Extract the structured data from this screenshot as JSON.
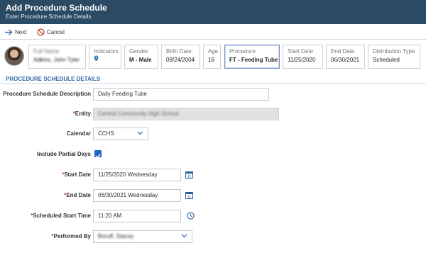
{
  "header": {
    "title": "Add Procedure Schedule",
    "subtitle": "Enter Procedure Schedule Details",
    "color": "#2b4a63"
  },
  "toolbar": {
    "next_label": "Next",
    "cancel_label": "Cancel",
    "next_icon": "arrow-right-icon",
    "cancel_icon": "cancel-circle-icon"
  },
  "cards": [
    {
      "label": "Full Name",
      "value": "Adkins, John Tyler",
      "blurred": true
    },
    {
      "label": "Indicators",
      "value": "",
      "icon": "location-pin-icon"
    },
    {
      "label": "Gender",
      "value": "M - Male"
    },
    {
      "label": "Birth Date",
      "value": "09/24/2004"
    },
    {
      "label": "Age",
      "value": "16"
    },
    {
      "label": "Procedure",
      "value": "FT - Feeding Tube",
      "selected": true
    },
    {
      "label": "Start Date",
      "value": "11/25/2020"
    },
    {
      "label": "End Date",
      "value": "06/30/2021"
    },
    {
      "label": "Distribution Type",
      "value": "Scheduled"
    }
  ],
  "section_title": "PROCEDURE SCHEDULE DETAILS",
  "form": {
    "description": {
      "label": "Procedure Schedule Description",
      "value": "Daily Feeding Tube"
    },
    "entity": {
      "required": "*",
      "label": "Entity",
      "value": "Central Community High School",
      "blurred": true
    },
    "calendar": {
      "label": "Calendar",
      "value": "CCHS"
    },
    "partial_days": {
      "label": "Include Partial Days",
      "checked": true
    },
    "start_date": {
      "required": "*",
      "label": "Start Date",
      "value": "11/25/2020 Wednesday"
    },
    "end_date": {
      "required": "*",
      "label": "End Date",
      "value": "06/30/2021 Wednesday"
    },
    "start_time": {
      "required": "*",
      "label": "Scheduled Start Time",
      "value": "11:20 AM"
    },
    "performed_by": {
      "required": "*",
      "label": "Performed By",
      "value": "Boruff, Stacey",
      "blurred": true
    }
  },
  "accent_color": "#2066c8"
}
